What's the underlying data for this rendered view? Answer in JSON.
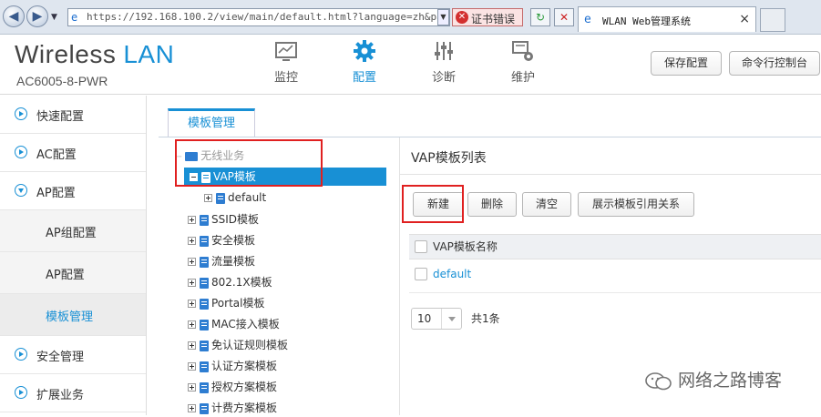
{
  "browser": {
    "url": "https://192.168.100.2/view/main/default.html?language=zh&page",
    "cert_error": "证书错误",
    "tab_title": "WLAN Web管理系统",
    "close_glyph": "×"
  },
  "header": {
    "brand_left": "Wireless",
    "brand_right": "LAN",
    "model": "AC6005-8-PWR",
    "menus": [
      {
        "label": "监控",
        "icon": "monitor-icon"
      },
      {
        "label": "配置",
        "icon": "gear-icon"
      },
      {
        "label": "诊断",
        "icon": "sliders-icon"
      },
      {
        "label": "维护",
        "icon": "maintenance-icon"
      }
    ],
    "save_config": "保存配置",
    "cli_console": "命令行控制台"
  },
  "sidebar": {
    "items": [
      {
        "label": "快速配置"
      },
      {
        "label": "AC配置"
      },
      {
        "label": "AP配置"
      },
      {
        "label": "AP组配置"
      },
      {
        "label": "AP配置"
      },
      {
        "label": "模板管理"
      },
      {
        "label": "安全管理"
      },
      {
        "label": "扩展业务"
      }
    ]
  },
  "content": {
    "tab_label": "模板管理",
    "tree": {
      "root": "无线业务",
      "nodes": [
        {
          "label": "VAP模板"
        },
        {
          "label": "default"
        },
        {
          "label": "SSID模板"
        },
        {
          "label": "安全模板"
        },
        {
          "label": "流量模板"
        },
        {
          "label": "802.1X模板"
        },
        {
          "label": "Portal模板"
        },
        {
          "label": "MAC接入模板"
        },
        {
          "label": "免认证规则模板"
        },
        {
          "label": "认证方案模板"
        },
        {
          "label": "授权方案模板"
        },
        {
          "label": "计费方案模板"
        }
      ]
    },
    "panel": {
      "title": "VAP模板列表",
      "btn_new": "新建",
      "btn_delete": "删除",
      "btn_clear": "清空",
      "btn_show_ref": "展示模板引用关系",
      "col_name": "VAP模板名称",
      "rows": [
        "default"
      ],
      "page_size": "10",
      "total": "共1条"
    }
  },
  "watermark": "网络之路博客",
  "colors": {
    "accent": "#1890d5",
    "highlight": "#e02020"
  }
}
